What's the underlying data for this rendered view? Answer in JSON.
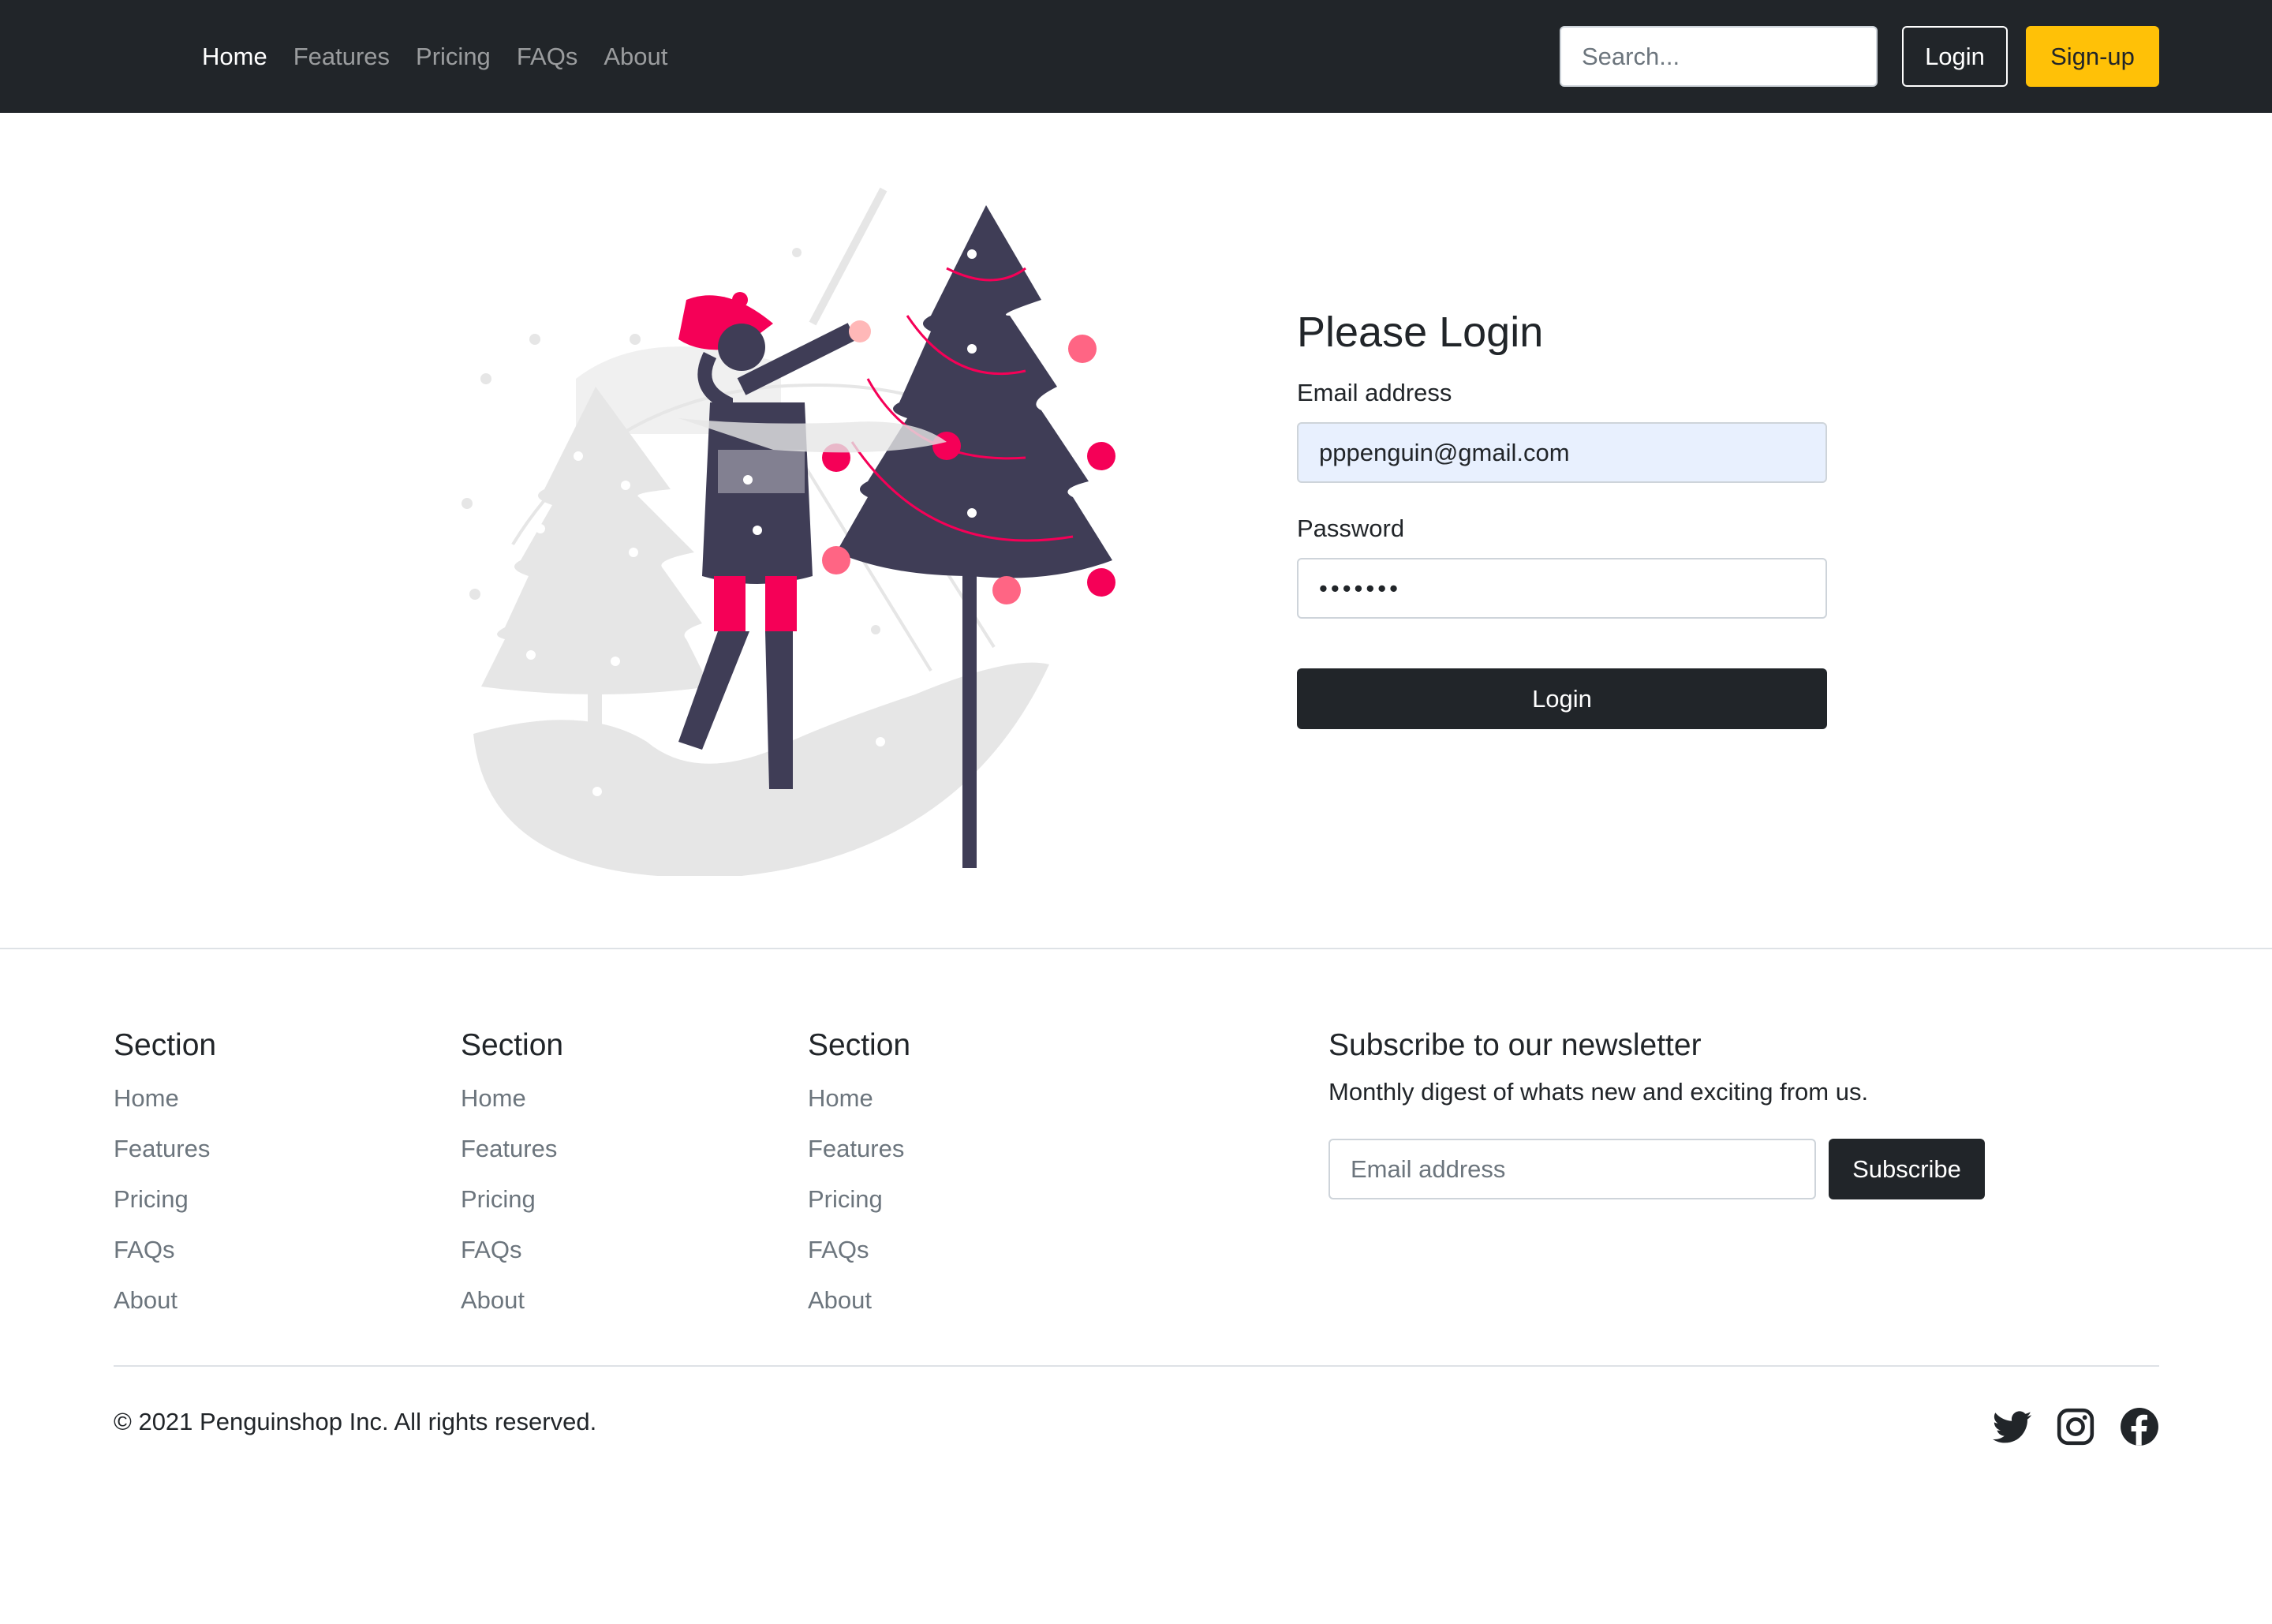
{
  "nav": {
    "links": [
      "Home",
      "Features",
      "Pricing",
      "FAQs",
      "About"
    ],
    "active": "Home",
    "search_placeholder": "Search...",
    "login_label": "Login",
    "signup_label": "Sign-up"
  },
  "login": {
    "title": "Please Login",
    "email_label": "Email address",
    "email_value": "pppenguin@gmail.com",
    "password_label": "Password",
    "password_value": "•••••••",
    "submit_label": "Login"
  },
  "footer": {
    "sections": [
      {
        "title": "Section",
        "links": [
          "Home",
          "Features",
          "Pricing",
          "FAQs",
          "About"
        ]
      },
      {
        "title": "Section",
        "links": [
          "Home",
          "Features",
          "Pricing",
          "FAQs",
          "About"
        ]
      },
      {
        "title": "Section",
        "links": [
          "Home",
          "Features",
          "Pricing",
          "FAQs",
          "About"
        ]
      }
    ],
    "newsletter": {
      "title": "Subscribe to our newsletter",
      "description": "Monthly digest of whats new and exciting from us.",
      "email_placeholder": "Email address",
      "subscribe_label": "Subscribe"
    },
    "copyright": "© 2021 Penguinshop Inc. All rights reserved.",
    "social_icons": [
      "twitter-icon",
      "instagram-icon",
      "facebook-icon"
    ]
  },
  "colors": {
    "navbar_bg": "#212529",
    "signup_bg": "#ffc107",
    "dark_button": "#212529",
    "autofill_bg": "#e8f0fe",
    "illustration_accent": "#f50057",
    "illustration_dark": "#3f3d56"
  }
}
